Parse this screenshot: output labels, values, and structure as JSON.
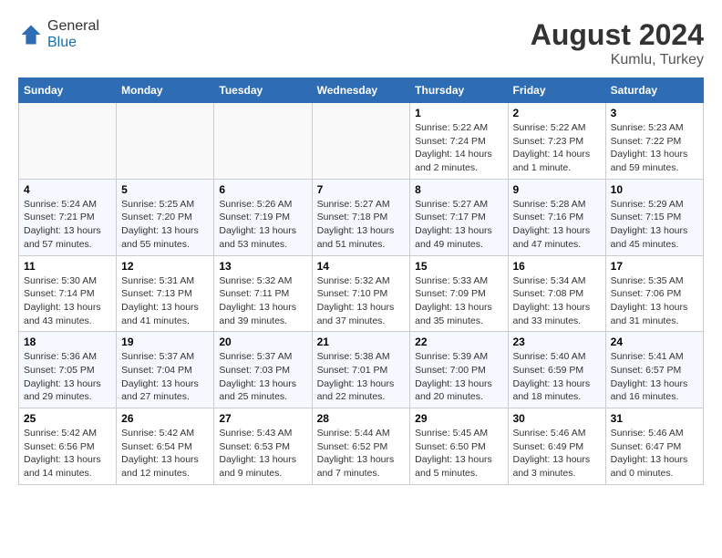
{
  "header": {
    "logo_general": "General",
    "logo_blue": "Blue",
    "month_year": "August 2024",
    "location": "Kumlu, Turkey"
  },
  "days_of_week": [
    "Sunday",
    "Monday",
    "Tuesday",
    "Wednesday",
    "Thursday",
    "Friday",
    "Saturday"
  ],
  "weeks": [
    [
      {
        "day": "",
        "info": ""
      },
      {
        "day": "",
        "info": ""
      },
      {
        "day": "",
        "info": ""
      },
      {
        "day": "",
        "info": ""
      },
      {
        "day": "1",
        "info": "Sunrise: 5:22 AM\nSunset: 7:24 PM\nDaylight: 14 hours\nand 2 minutes."
      },
      {
        "day": "2",
        "info": "Sunrise: 5:22 AM\nSunset: 7:23 PM\nDaylight: 14 hours\nand 1 minute."
      },
      {
        "day": "3",
        "info": "Sunrise: 5:23 AM\nSunset: 7:22 PM\nDaylight: 13 hours\nand 59 minutes."
      }
    ],
    [
      {
        "day": "4",
        "info": "Sunrise: 5:24 AM\nSunset: 7:21 PM\nDaylight: 13 hours\nand 57 minutes."
      },
      {
        "day": "5",
        "info": "Sunrise: 5:25 AM\nSunset: 7:20 PM\nDaylight: 13 hours\nand 55 minutes."
      },
      {
        "day": "6",
        "info": "Sunrise: 5:26 AM\nSunset: 7:19 PM\nDaylight: 13 hours\nand 53 minutes."
      },
      {
        "day": "7",
        "info": "Sunrise: 5:27 AM\nSunset: 7:18 PM\nDaylight: 13 hours\nand 51 minutes."
      },
      {
        "day": "8",
        "info": "Sunrise: 5:27 AM\nSunset: 7:17 PM\nDaylight: 13 hours\nand 49 minutes."
      },
      {
        "day": "9",
        "info": "Sunrise: 5:28 AM\nSunset: 7:16 PM\nDaylight: 13 hours\nand 47 minutes."
      },
      {
        "day": "10",
        "info": "Sunrise: 5:29 AM\nSunset: 7:15 PM\nDaylight: 13 hours\nand 45 minutes."
      }
    ],
    [
      {
        "day": "11",
        "info": "Sunrise: 5:30 AM\nSunset: 7:14 PM\nDaylight: 13 hours\nand 43 minutes."
      },
      {
        "day": "12",
        "info": "Sunrise: 5:31 AM\nSunset: 7:13 PM\nDaylight: 13 hours\nand 41 minutes."
      },
      {
        "day": "13",
        "info": "Sunrise: 5:32 AM\nSunset: 7:11 PM\nDaylight: 13 hours\nand 39 minutes."
      },
      {
        "day": "14",
        "info": "Sunrise: 5:32 AM\nSunset: 7:10 PM\nDaylight: 13 hours\nand 37 minutes."
      },
      {
        "day": "15",
        "info": "Sunrise: 5:33 AM\nSunset: 7:09 PM\nDaylight: 13 hours\nand 35 minutes."
      },
      {
        "day": "16",
        "info": "Sunrise: 5:34 AM\nSunset: 7:08 PM\nDaylight: 13 hours\nand 33 minutes."
      },
      {
        "day": "17",
        "info": "Sunrise: 5:35 AM\nSunset: 7:06 PM\nDaylight: 13 hours\nand 31 minutes."
      }
    ],
    [
      {
        "day": "18",
        "info": "Sunrise: 5:36 AM\nSunset: 7:05 PM\nDaylight: 13 hours\nand 29 minutes."
      },
      {
        "day": "19",
        "info": "Sunrise: 5:37 AM\nSunset: 7:04 PM\nDaylight: 13 hours\nand 27 minutes."
      },
      {
        "day": "20",
        "info": "Sunrise: 5:37 AM\nSunset: 7:03 PM\nDaylight: 13 hours\nand 25 minutes."
      },
      {
        "day": "21",
        "info": "Sunrise: 5:38 AM\nSunset: 7:01 PM\nDaylight: 13 hours\nand 22 minutes."
      },
      {
        "day": "22",
        "info": "Sunrise: 5:39 AM\nSunset: 7:00 PM\nDaylight: 13 hours\nand 20 minutes."
      },
      {
        "day": "23",
        "info": "Sunrise: 5:40 AM\nSunset: 6:59 PM\nDaylight: 13 hours\nand 18 minutes."
      },
      {
        "day": "24",
        "info": "Sunrise: 5:41 AM\nSunset: 6:57 PM\nDaylight: 13 hours\nand 16 minutes."
      }
    ],
    [
      {
        "day": "25",
        "info": "Sunrise: 5:42 AM\nSunset: 6:56 PM\nDaylight: 13 hours\nand 14 minutes."
      },
      {
        "day": "26",
        "info": "Sunrise: 5:42 AM\nSunset: 6:54 PM\nDaylight: 13 hours\nand 12 minutes."
      },
      {
        "day": "27",
        "info": "Sunrise: 5:43 AM\nSunset: 6:53 PM\nDaylight: 13 hours\nand 9 minutes."
      },
      {
        "day": "28",
        "info": "Sunrise: 5:44 AM\nSunset: 6:52 PM\nDaylight: 13 hours\nand 7 minutes."
      },
      {
        "day": "29",
        "info": "Sunrise: 5:45 AM\nSunset: 6:50 PM\nDaylight: 13 hours\nand 5 minutes."
      },
      {
        "day": "30",
        "info": "Sunrise: 5:46 AM\nSunset: 6:49 PM\nDaylight: 13 hours\nand 3 minutes."
      },
      {
        "day": "31",
        "info": "Sunrise: 5:46 AM\nSunset: 6:47 PM\nDaylight: 13 hours\nand 0 minutes."
      }
    ]
  ]
}
